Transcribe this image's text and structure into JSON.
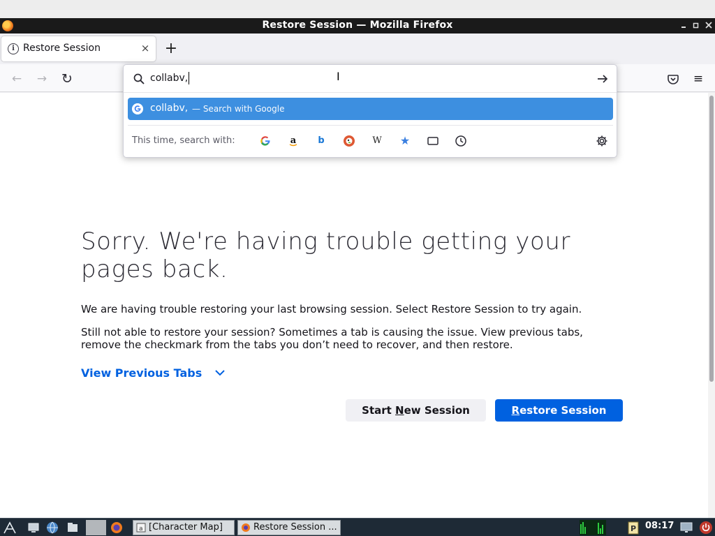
{
  "window": {
    "title": "Restore Session — Mozilla Firefox",
    "controls": [
      "minimize",
      "maximize",
      "close"
    ]
  },
  "tab": {
    "title": "Restore Session",
    "info_icon": "info-icon",
    "close_glyph": "×"
  },
  "newtab": {
    "glyph": "+"
  },
  "nav": {
    "back": "←",
    "forward": "→",
    "reload": "↻",
    "menu": "≡"
  },
  "urlbar": {
    "value": "collabv,",
    "suggestion": {
      "text": "collabv,",
      "action": "— Search with Google"
    },
    "oneoff_label": "This time, search with:",
    "engines": [
      "google",
      "amazon",
      "bing",
      "duckduckgo",
      "wikipedia",
      "bookmarks",
      "tabs",
      "history"
    ],
    "engine_glyphs": {
      "amazon": "a",
      "bing": "b",
      "wikipedia": "W",
      "bookmarks": "★"
    }
  },
  "page": {
    "heading": "Sorry. We're having trouble getting your pages back.",
    "para1": "We are having trouble restoring your last browsing session. Select Restore Session to try again.",
    "para2": "Still not able to restore your session? Sometimes a tab is causing the issue. View previous tabs, remove the checkmark from the tabs you don’t need to recover, and then restore.",
    "view_previous": "View Previous Tabs",
    "start_new": {
      "before": "Start ",
      "key": "N",
      "after": "ew Session"
    },
    "restore": {
      "before": "",
      "key": "R",
      "after": "estore Session"
    }
  },
  "taskbar": {
    "tasks": [
      {
        "label": "[Character Map]"
      },
      {
        "label": "Restore Session ..."
      }
    ],
    "clock": "08:17"
  },
  "colors": {
    "accent": "#0061e0",
    "suggestion_bg": "#3d8fe0",
    "titlebar": "#1a1a1a",
    "taskbar": "#1e2a36"
  }
}
